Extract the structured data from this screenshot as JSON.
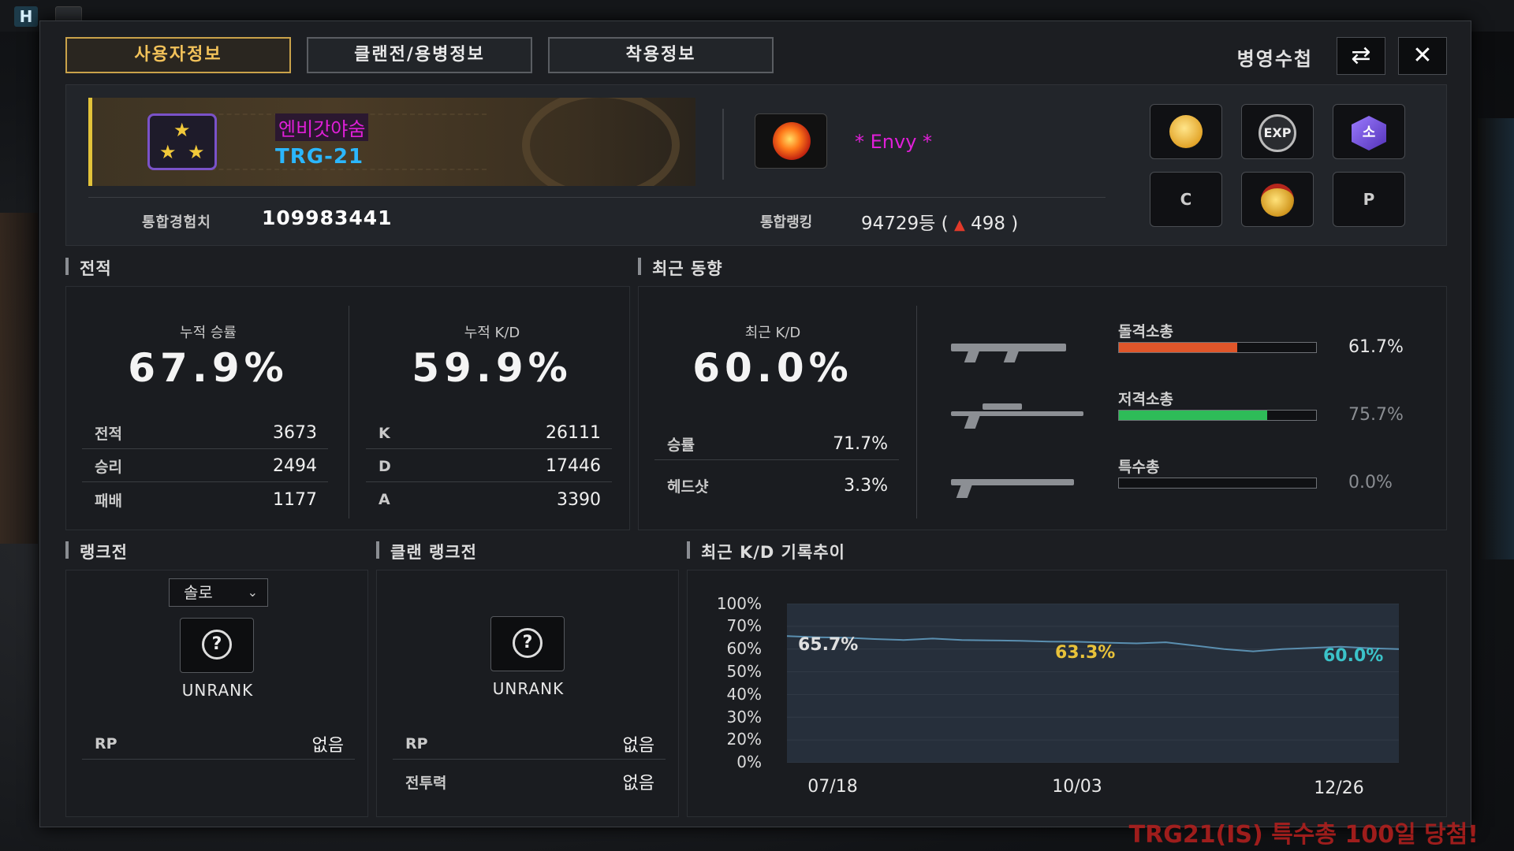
{
  "topbar": {
    "logo": "H"
  },
  "tabs": [
    {
      "label": "사용자정보",
      "active": true
    },
    {
      "label": "클랜전/용병정보",
      "active": false
    },
    {
      "label": "착용정보",
      "active": false
    }
  ],
  "header": {
    "title": "병영수첩",
    "swap_icon": "⇄",
    "close_icon": "✕"
  },
  "profile": {
    "nickname": "엔비갓야숨",
    "weapon": "TRG-21",
    "clan_name": "* Envy *",
    "exp_label": "통합경험치",
    "exp_value": "109983441",
    "rank_label": "통합랭킹",
    "rank_value": "94729등 (",
    "rank_change_icon": "▲",
    "rank_change": "498 )",
    "buttons": {
      "c": "C",
      "p": "P",
      "exp": "EXP",
      "hex": "소"
    }
  },
  "record": {
    "title": "전적",
    "winrate_label": "누적 승률",
    "winrate": "67.9%",
    "kd_label": "누적 K/D",
    "kd": "59.9%",
    "left_rows": [
      {
        "k": "전적",
        "v": "3673"
      },
      {
        "k": "승리",
        "v": "2494"
      },
      {
        "k": "패배",
        "v": "1177"
      }
    ],
    "right_rows": [
      {
        "k": "K",
        "v": "26111"
      },
      {
        "k": "D",
        "v": "17446"
      },
      {
        "k": "A",
        "v": "3390"
      }
    ]
  },
  "recent": {
    "title": "최근 동향",
    "kd_label": "최근 K/D",
    "kd": "60.0%",
    "rows": [
      {
        "k": "승률",
        "v": "71.7%"
      },
      {
        "k": "헤드샷",
        "v": "3.3%"
      }
    ],
    "weapons": [
      {
        "name": "돌격소총",
        "value": "61.7%",
        "fraction": 0.6,
        "color": "#e0562a"
      },
      {
        "name": "저격소총",
        "value": "75.7%",
        "fraction": 0.75,
        "color": "#2ebc58"
      },
      {
        "name": "특수총",
        "value": "0.0%",
        "fraction": 0.0,
        "color": "#888888"
      }
    ]
  },
  "ranked": {
    "title": "랭크전",
    "mode": "솔로",
    "mode_chevron": "⌄",
    "q_icon": "?",
    "status": "UNRANK",
    "rp_label": "RP",
    "rp_value": "없음"
  },
  "clan_ranked": {
    "title": "클랜 랭크전",
    "q_icon": "?",
    "status": "UNRANK",
    "rp_label": "RP",
    "rp_value": "없음",
    "power_label": "전투력",
    "power_value": "없음"
  },
  "kd_chart": {
    "title": "최근 K/D 기록추이"
  },
  "chart_data": {
    "type": "line",
    "title": "최근 K/D 기록추이",
    "y_ticks": [
      "100%",
      "70%",
      "60%",
      "50%",
      "40%",
      "30%",
      "20%",
      "0%"
    ],
    "x_ticks": [
      "07/18",
      "10/03",
      "12/26"
    ],
    "series": [
      {
        "values": [
          65.7,
          65.2,
          65.0,
          64.4,
          64.0,
          64.6,
          64.0,
          63.8,
          63.6,
          63.3,
          63.2,
          62.8,
          62.5,
          63.0,
          61.5,
          60.0,
          59.0,
          60.0,
          60.5,
          61.0,
          60.4,
          60.0
        ]
      }
    ],
    "labels": [
      {
        "text": "65.7%",
        "color": "#e0e0e0"
      },
      {
        "text": "63.3%",
        "color": "#e8c23a"
      },
      {
        "text": "60.0%",
        "color": "#3bc3c9"
      }
    ],
    "colors": {
      "line": "#5a8fb0",
      "fill": "#262f3b"
    }
  }
}
